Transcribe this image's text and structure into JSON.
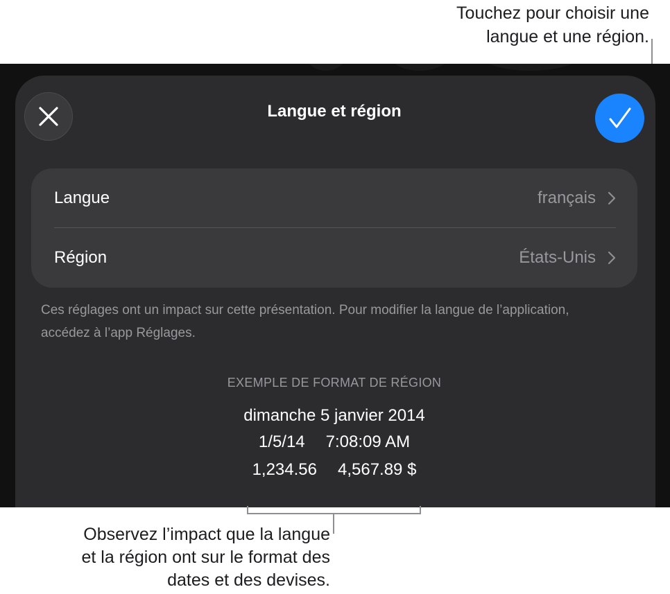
{
  "callouts": {
    "top": [
      "Touchez pour choisir une",
      "langue et une région."
    ],
    "bottom": [
      "Observez l’impact que la langue",
      "et la région ont sur le format des",
      "dates et des devises."
    ]
  },
  "sheet": {
    "title": "Langue et région",
    "close_icon": "close-icon",
    "done_icon": "checkmark-icon",
    "accent_color": "#1a84ff",
    "rows": [
      {
        "label": "Langue",
        "value": "français"
      },
      {
        "label": "Région",
        "value": "États-Unis"
      }
    ],
    "footnote": "Ces réglages ont un impact sur cette présentation. Pour modifier la langue de l’application, accédez à l’app Réglages.",
    "example": {
      "header": "EXEMPLE DE FORMAT DE RÉGION",
      "date_long": "dimanche 5 janvier 2014",
      "date_short": "1/5/14",
      "time": "7:08:09 AM",
      "number": "1,234.56",
      "currency": "4,567.89 $"
    }
  }
}
